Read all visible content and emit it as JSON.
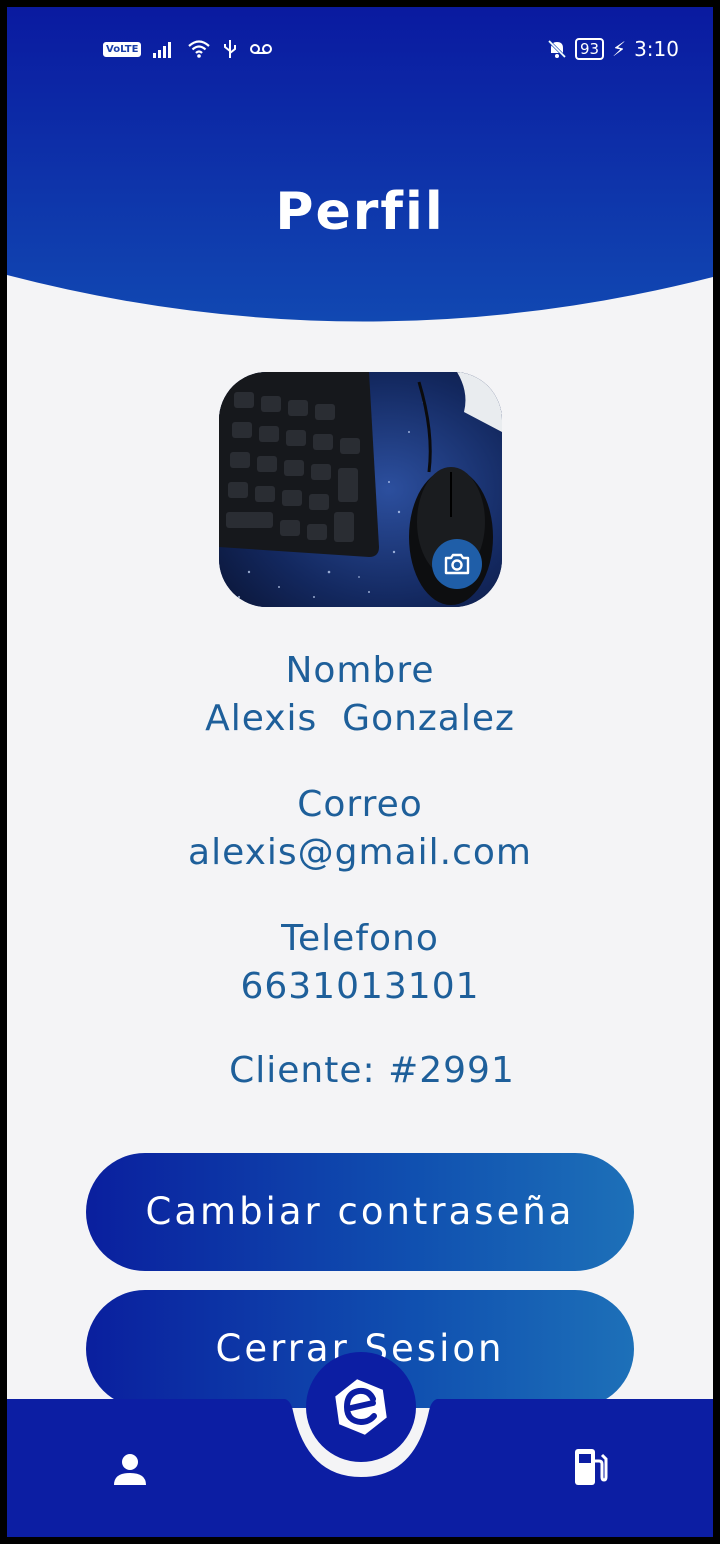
{
  "status_bar": {
    "network": "VoLTE",
    "battery": "93",
    "time": "3:10"
  },
  "header": {
    "title": "Perfil"
  },
  "profile": {
    "name_label": "Nombre",
    "name_value": "Alexis  Gonzalez",
    "email_label": "Correo",
    "email_value": "alexis@gmail.com",
    "phone_label": "Telefono",
    "phone_value": "6631013101",
    "client_text": "Cliente:  #2991"
  },
  "buttons": {
    "change_password": "Cambiar contraseña",
    "logout": "Cerrar Sesion"
  },
  "colors": {
    "primary": "#0c1ea3",
    "text": "#1e5f9a",
    "background": "#f4f4f6"
  },
  "icons": {
    "photo": "profile-photo",
    "camera": "camera-icon",
    "fab": "app-logo-icon",
    "nav_left": "user-icon",
    "nav_right": "fuel-pump-icon"
  }
}
